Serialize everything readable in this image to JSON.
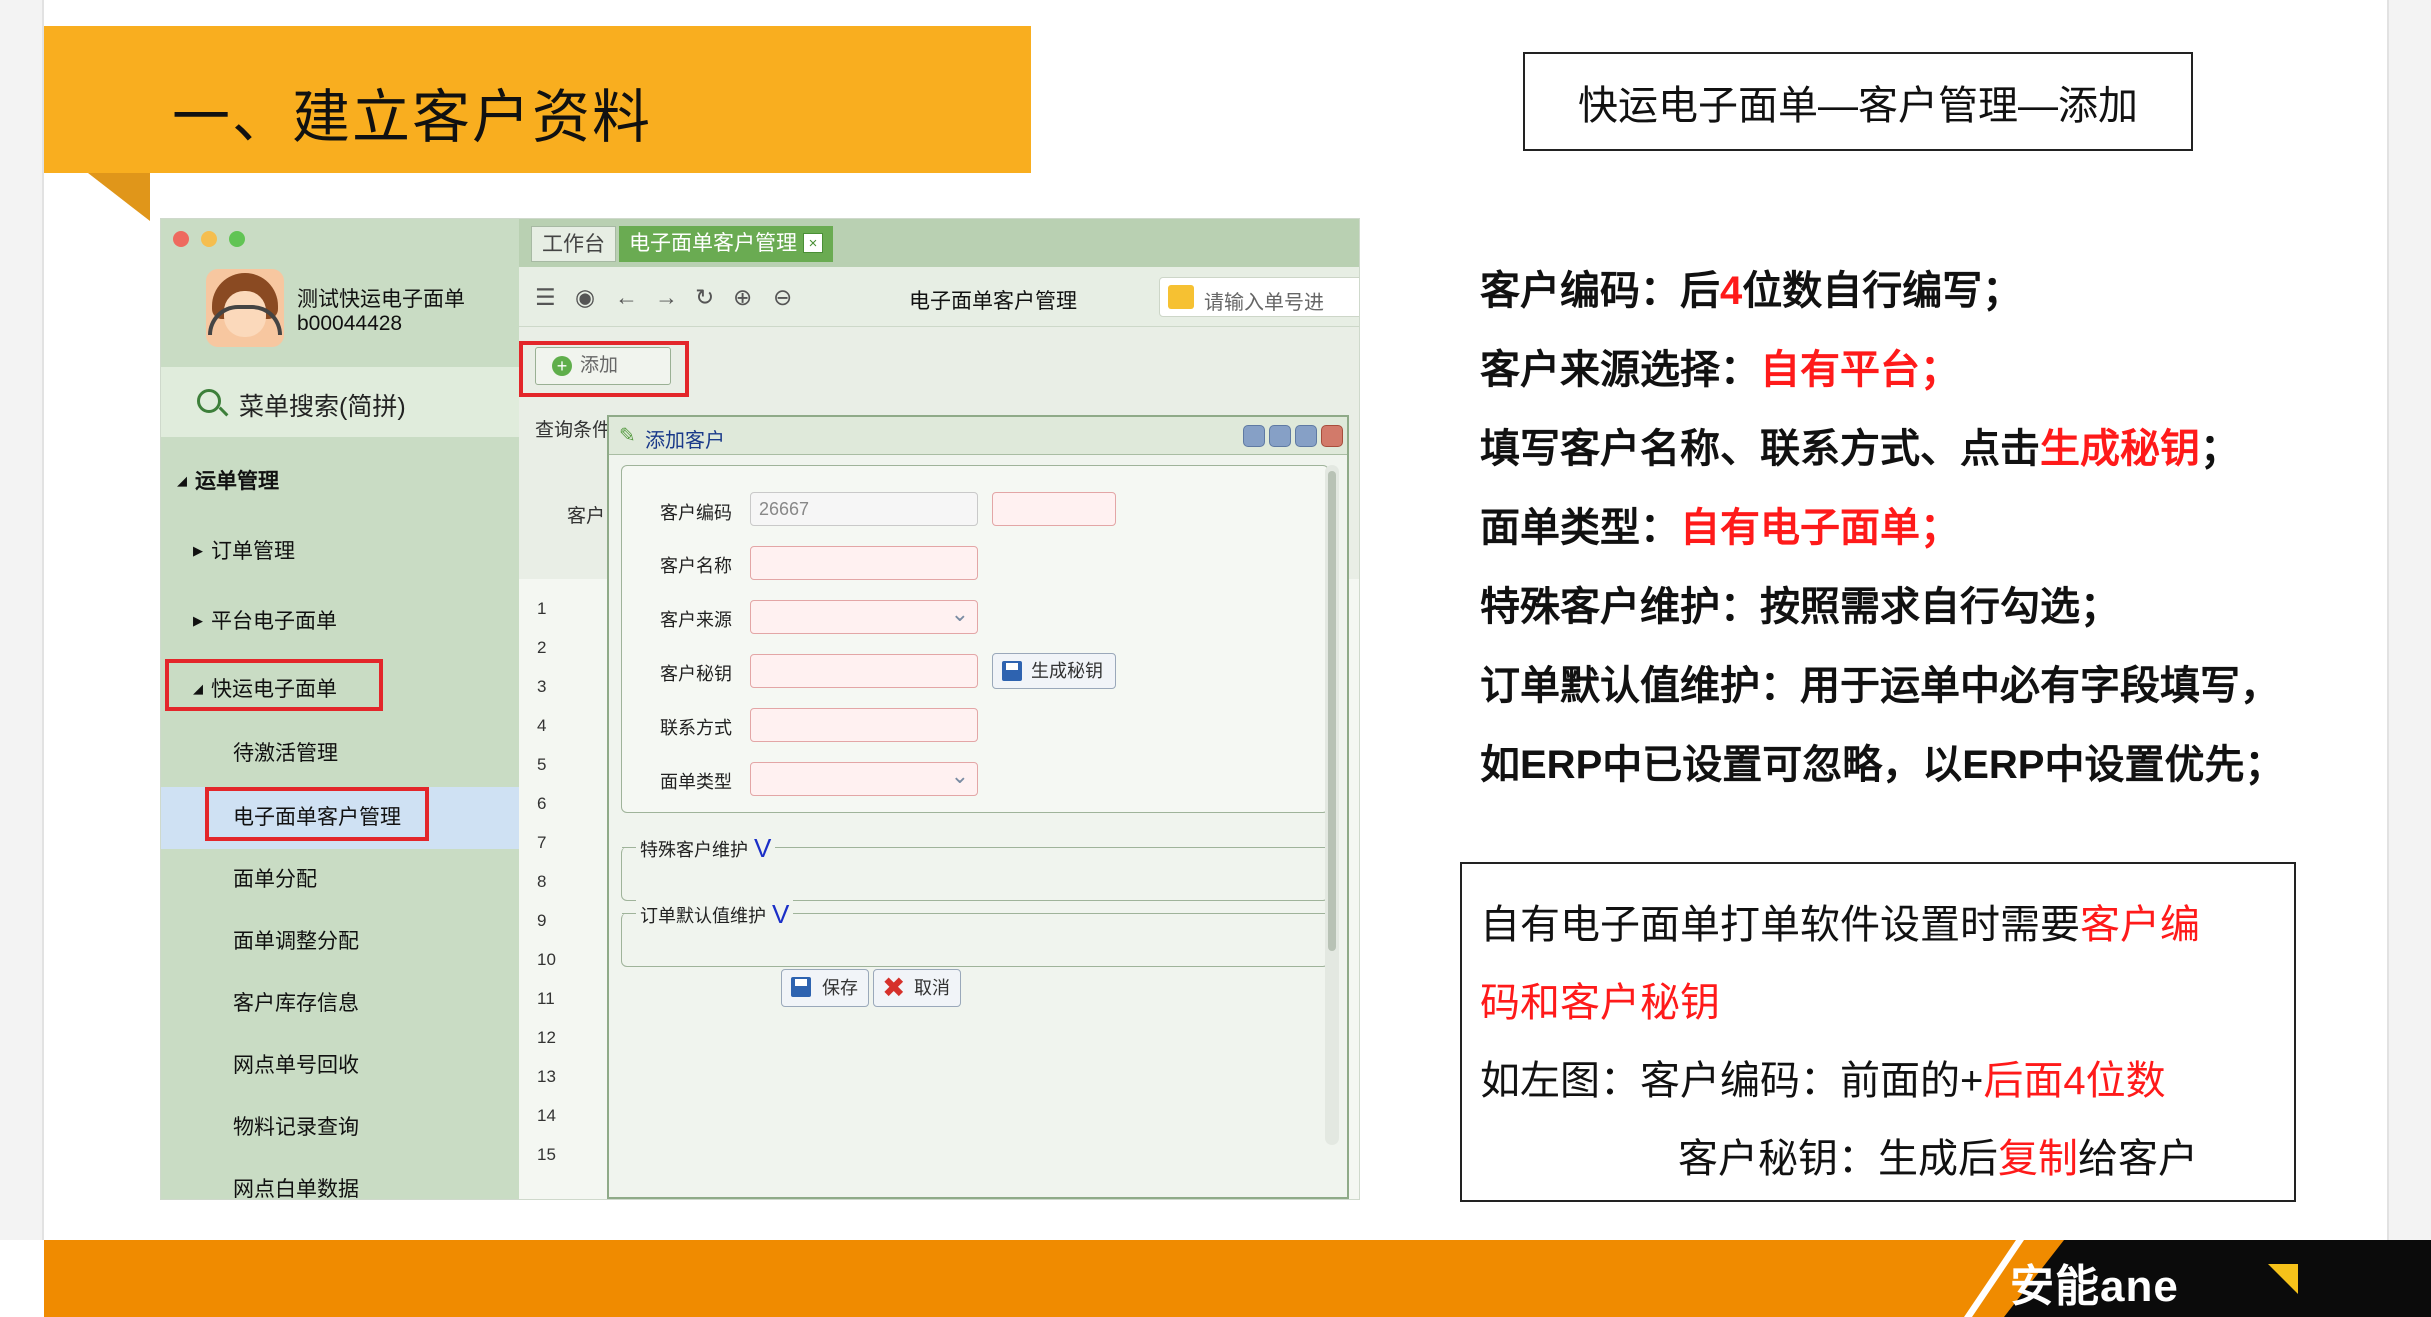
{
  "slide": {
    "title": "一、建立客户资料",
    "path_box": "快运电子面单—客户管理—添加"
  },
  "app": {
    "user_name": "测试快运电子面单",
    "user_id": "b00044428",
    "menu_search": "菜单搜索(简拼)",
    "nav": [
      {
        "label": "运单管理"
      },
      {
        "label": "订单管理"
      },
      {
        "label": "平台电子面单"
      },
      {
        "label": "快运电子面单"
      },
      {
        "label": "待激活管理"
      },
      {
        "label": "电子面单客户管理"
      },
      {
        "label": "面单分配"
      },
      {
        "label": "面单调整分配"
      },
      {
        "label": "客户库存信息"
      },
      {
        "label": "网点单号回收"
      },
      {
        "label": "物料记录查询"
      },
      {
        "label": "网点白单数据"
      }
    ],
    "tabs": {
      "home": "工作台",
      "active": "电子面单客户管理",
      "close": "×"
    },
    "toolbar": {
      "title": "电子面单客户管理",
      "search_placeholder": "请输入单号进",
      "icons": [
        "menu-icon",
        "eye-icon",
        "back-arrow-icon",
        "forward-arrow-icon",
        "refresh-icon",
        "zoom-in-icon",
        "zoom-out-icon"
      ]
    },
    "add_button": "添加",
    "query_label": "查询条件",
    "customer_label": "客户",
    "row_numbers": [
      "1",
      "2",
      "3",
      "4",
      "5",
      "6",
      "7",
      "8",
      "9",
      "10",
      "11",
      "12",
      "13",
      "14",
      "15"
    ],
    "dialog": {
      "title": "添加客户",
      "fields": {
        "code_label": "客户编码",
        "code_value": "26667",
        "name_label": "客户名称",
        "source_label": "客户来源",
        "secret_label": "客户秘钥",
        "contact_label": "联系方式",
        "type_label": "面单类型"
      },
      "generate_button": "生成秘钥",
      "section_special": "特殊客户维护",
      "section_default": "订单默认值维护",
      "section_marker": "V",
      "save_button": "保存",
      "cancel_button": "取消"
    }
  },
  "instructions": {
    "l1": {
      "a": "客户编码：后",
      "b": "4",
      "c": "位数自行编写；"
    },
    "l2": {
      "a": "客户来源选择：",
      "b": "自有平台；"
    },
    "l3": {
      "a": "填写客户名称、联系方式、点击",
      "b": "生成秘钥",
      "c": "；"
    },
    "l4": {
      "a": "面单类型：",
      "b": "自有电子面单；"
    },
    "l5": "特殊客户维护：按照需求自行勾选；",
    "l6": "订单默认值维护：用于运单中必有字段填写，",
    "l7": "如ERP中已设置可忽略，以ERP中设置优先；"
  },
  "note": {
    "l1a": "自有电子面单打单软件设置时需要",
    "l1b": "客户编",
    "l2": "码和客户秘钥",
    "l3a": "如左图：客户编码：前面的+",
    "l3b": "后面4位数",
    "l4a": "客户秘钥：生成后",
    "l4b": "复制",
    "l4c": "给客户"
  },
  "footer": {
    "logo_text": "安能ane"
  },
  "colors": {
    "banner": "#f9ae1f",
    "footer": "#f08b00",
    "highlight": "#ff1a1a",
    "app_green": "#6aab52"
  }
}
